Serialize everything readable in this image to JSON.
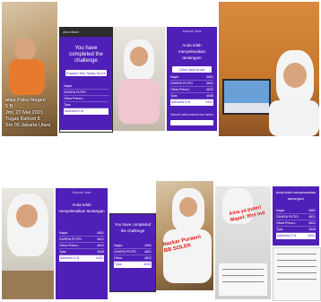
{
  "top_row": {
    "photo_caption": [
      "atlas Palsu Negeri",
      "5 B",
      "Jmi, 27 Mei 2021",
      "Tugas Kahoot 8",
      "Sm 05 Jakarta Utara"
    ],
    "phone_header": "about:blank",
    "challenge_text": "You have completed the challenge",
    "results_button": "Expand this Today Score",
    "ranking_items": [
      "Nayla",
      "ZAHIRA PUTRI",
      "Olivia Prima L",
      "Tyas",
      "Adhistira D.N"
    ],
    "tablet_title_top": "Kahoot! Jeda",
    "tablet_heading": "Anda telah menyelesaikan tantangan!",
    "tablet_button": "Lihat hasil Anda",
    "tablet_rows": [
      {
        "name": "Nayla",
        "score": "4951"
      },
      {
        "name": "ZAHIRA PUTRI",
        "score": "4821"
      },
      {
        "name": "Olivia Prima L",
        "score": "4622"
      },
      {
        "name": "Tyas",
        "score": "4545"
      },
      {
        "name": "Adhistira D.N",
        "score": "4400"
      }
    ],
    "tablet_footer": "Kahoot! untuk sekolah dan rumah"
  },
  "bottom_row": {
    "phone1_top": "Kahoot! Jeda",
    "phone1_heading": "Anda telah menyelesaikan tantangan",
    "phone1_rows": [
      {
        "name": "Nayla",
        "score": "4951"
      },
      {
        "name": "ZAHIRA PUTRI",
        "score": "4821"
      },
      {
        "name": "Olivia Prima L",
        "score": "4622"
      },
      {
        "name": "Tyas",
        "score": "4545"
      },
      {
        "name": "Adhistira D.N",
        "score": "4400"
      }
    ],
    "phone2_heading": "You have completed the challenge",
    "phone2_rows": [
      {
        "name": "Nayla",
        "score": "4951"
      },
      {
        "name": "ZAHIRA PUTRI",
        "score": "4821"
      },
      {
        "name": "Olivia",
        "score": "4622"
      },
      {
        "name": "Tyas",
        "score": "4545"
      }
    ],
    "red_text_1": [
      "Nazkar Puraeni",
      "BB SOLEK"
    ],
    "red_text_2": [
      "Aina ya puteri",
      "Mapel: Bhs Ind"
    ],
    "panel_heading": "Anda telah menyelesaikan tantangan!",
    "panel_rows": [
      {
        "name": "Nayla",
        "score": "4951"
      },
      {
        "name": "ZAHIRA PUTRI",
        "score": "4821"
      },
      {
        "name": "Olivia Prima L",
        "score": "4622"
      },
      {
        "name": "Tyas",
        "score": "4545"
      },
      {
        "name": "Adhistira D.N",
        "score": "4400"
      }
    ]
  },
  "colors": {
    "kahoot_purple": "#4f1fb7",
    "annotation_red": "#e01818"
  }
}
